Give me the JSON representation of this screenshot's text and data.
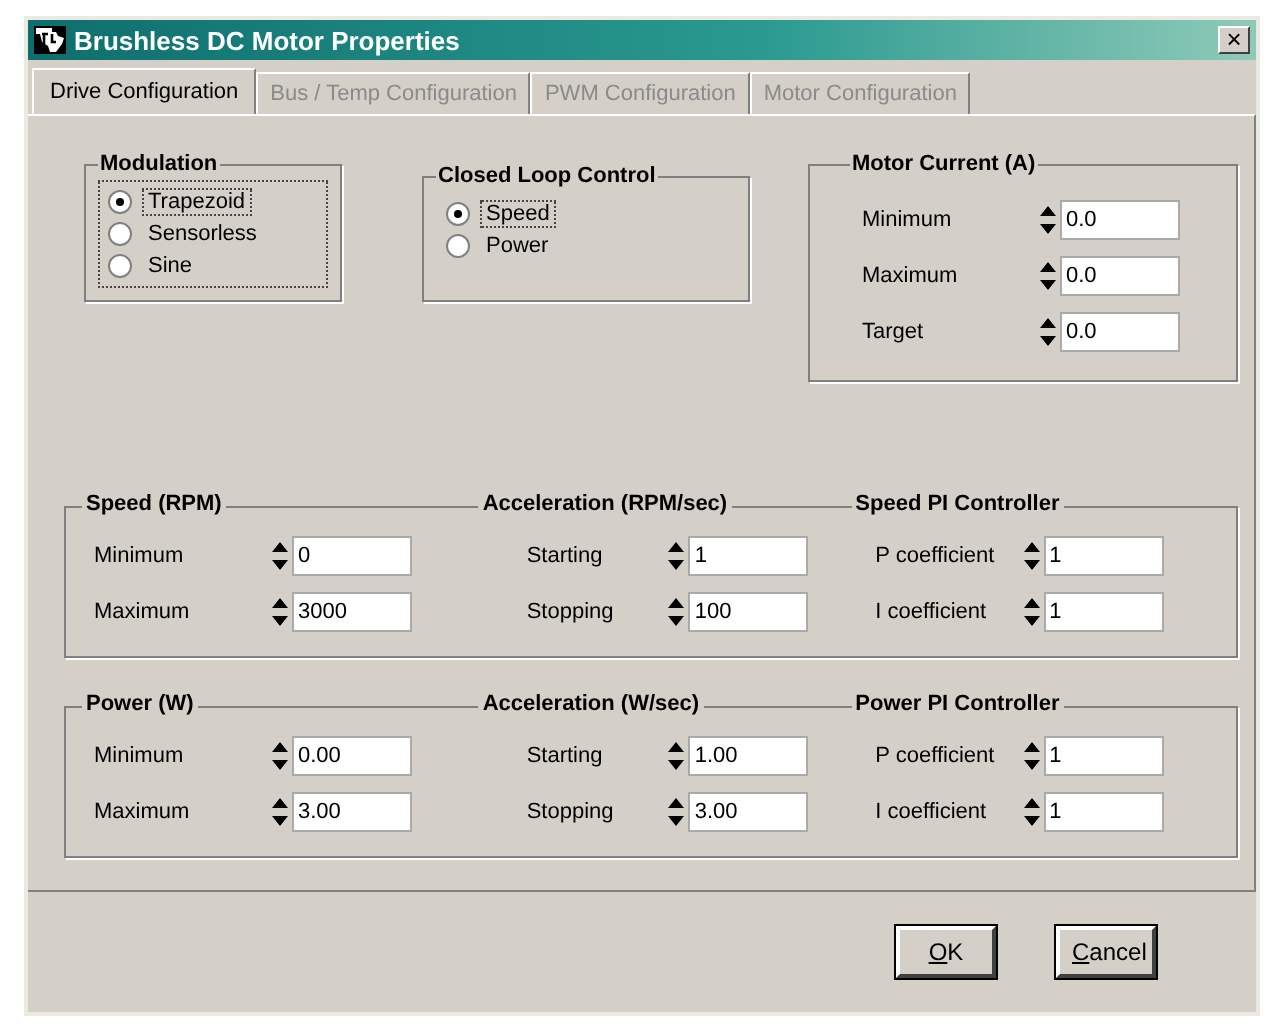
{
  "window": {
    "title": "Brushless DC Motor Properties",
    "close": "×"
  },
  "tabs": [
    {
      "label": "Drive Configuration",
      "selected": true,
      "disabled": false
    },
    {
      "label": "Bus / Temp Configuration",
      "selected": false,
      "disabled": true
    },
    {
      "label": "PWM Configuration",
      "selected": false,
      "disabled": true
    },
    {
      "label": "Motor Configuration",
      "selected": false,
      "disabled": true
    }
  ],
  "modulation": {
    "title": "Modulation",
    "focused": true,
    "options": [
      {
        "label": "Trapezoid",
        "selected": true,
        "focused": true
      },
      {
        "label": "Sensorless",
        "selected": false,
        "focused": false
      },
      {
        "label": "Sine",
        "selected": false,
        "focused": false
      }
    ]
  },
  "closed_loop": {
    "title": "Closed Loop Control",
    "options": [
      {
        "label": "Speed",
        "selected": true,
        "focused": true
      },
      {
        "label": "Power",
        "selected": false,
        "focused": false
      }
    ]
  },
  "motor_current": {
    "title": "Motor Current (A)",
    "fields": [
      {
        "label": "Minimum",
        "value": "0.0"
      },
      {
        "label": "Maximum",
        "value": "0.0"
      },
      {
        "label": "Target",
        "value": "0.0"
      }
    ]
  },
  "panels": [
    {
      "sections": [
        {
          "title": "Speed (RPM)",
          "fields": [
            {
              "label": "Minimum",
              "value": "0"
            },
            {
              "label": "Maximum",
              "value": "3000"
            }
          ]
        },
        {
          "title": "Acceleration (RPM/sec)",
          "fields": [
            {
              "label": "Starting",
              "value": "1"
            },
            {
              "label": "Stopping",
              "value": "100"
            }
          ]
        },
        {
          "title": "Speed PI Controller",
          "fields": [
            {
              "label": "P coefficient",
              "value": "1"
            },
            {
              "label": "I coefficient",
              "value": "1"
            }
          ]
        }
      ]
    },
    {
      "sections": [
        {
          "title": "Power (W)",
          "fields": [
            {
              "label": "Minimum",
              "value": "0.00"
            },
            {
              "label": "Maximum",
              "value": "3.00"
            }
          ]
        },
        {
          "title": "Acceleration (W/sec)",
          "fields": [
            {
              "label": "Starting",
              "value": "1.00"
            },
            {
              "label": "Stopping",
              "value": "3.00"
            }
          ]
        },
        {
          "title": "Power PI Controller",
          "fields": [
            {
              "label": "P coefficient",
              "value": "1"
            },
            {
              "label": "I coefficient",
              "value": "1"
            }
          ]
        }
      ]
    }
  ],
  "buttons": [
    {
      "label": "OK",
      "mnemonic": true
    },
    {
      "label": "Cancel",
      "mnemonic": true
    }
  ]
}
